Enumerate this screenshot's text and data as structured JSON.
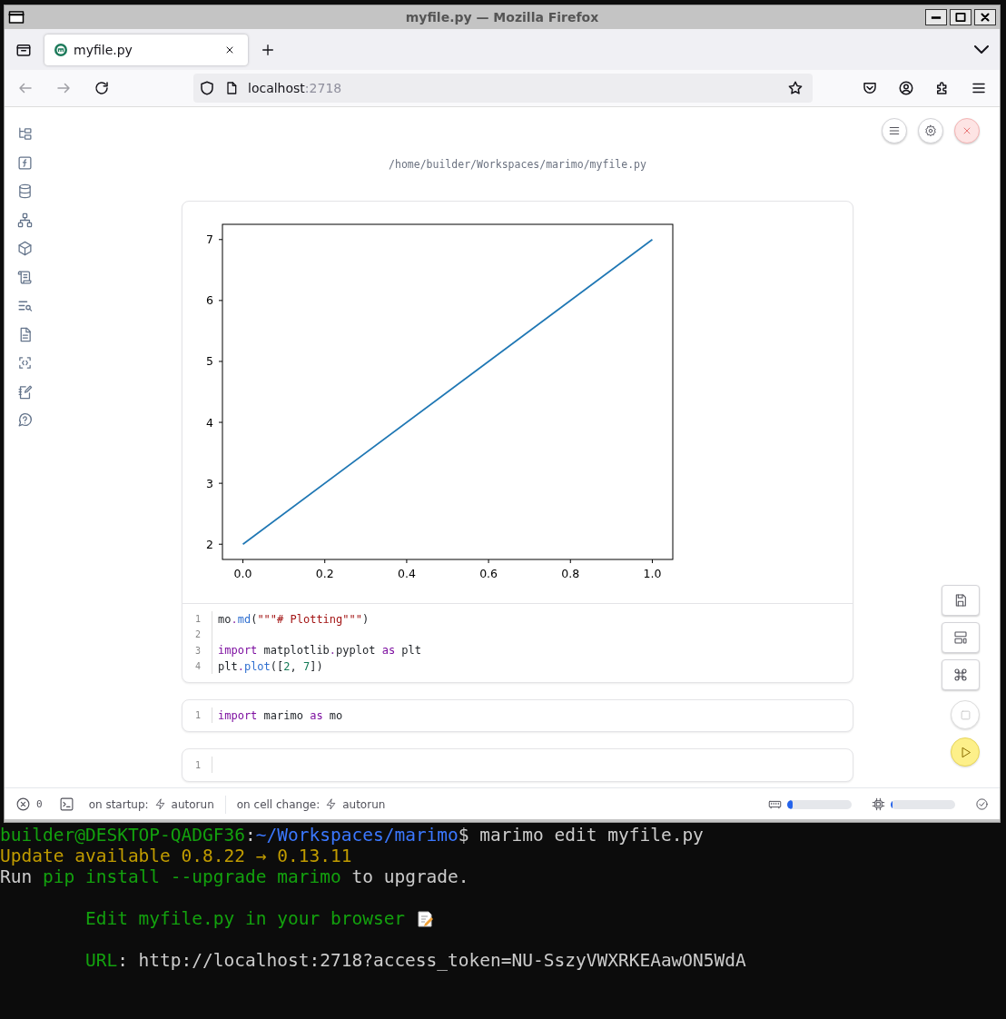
{
  "window": {
    "title": "myfile.py — Mozilla Firefox"
  },
  "tabs": [
    {
      "label": "myfile.py",
      "selected": true
    }
  ],
  "address_bar": {
    "host": "localhost",
    "port": ":2718"
  },
  "notebook": {
    "path": "/home/builder/Workspaces/marimo/myfile.py",
    "cells": [
      {
        "chart_data": {
          "type": "line",
          "x": [
            0,
            1
          ],
          "series": [
            {
              "color": "#1f77b4",
              "values": [
                2,
                7
              ]
            }
          ],
          "xlim": [
            -0.05,
            1.05
          ],
          "ylim": [
            1.75,
            7.25
          ],
          "xticks": [
            {
              "value": 0,
              "label": "0.0"
            },
            {
              "value": 0.2,
              "label": "0.2"
            },
            {
              "value": 0.4,
              "label": "0.4"
            },
            {
              "value": 0.6,
              "label": "0.6"
            },
            {
              "value": 0.8,
              "label": "0.8"
            },
            {
              "value": 1,
              "label": "1.0"
            }
          ],
          "yticks": [
            2,
            3,
            4,
            5,
            6,
            7
          ]
        },
        "lines": [
          {
            "number": "1",
            "tokens": [
              {
                "kind": "plain",
                "text": "mo"
              },
              {
                "kind": "punct",
                "text": "."
              },
              {
                "kind": "func",
                "text": "md"
              },
              {
                "kind": "plain",
                "text": "("
              },
              {
                "kind": "string",
                "text": "\"\"\"# Plotting\"\"\""
              },
              {
                "kind": "plain",
                "text": ")"
              }
            ]
          },
          {
            "number": "2"
          },
          {
            "number": "3",
            "tokens": [
              {
                "kind": "keyword",
                "text": "import"
              },
              {
                "kind": "plain",
                "text": " matplotlib"
              },
              {
                "kind": "punct",
                "text": "."
              },
              {
                "kind": "plain",
                "text": "pyplot "
              },
              {
                "kind": "keyword",
                "text": "as"
              },
              {
                "kind": "plain",
                "text": " plt"
              }
            ]
          },
          {
            "number": "4",
            "tokens": [
              {
                "kind": "plain",
                "text": "plt"
              },
              {
                "kind": "punct",
                "text": "."
              },
              {
                "kind": "func",
                "text": "plot"
              },
              {
                "kind": "plain",
                "text": "(["
              },
              {
                "kind": "number",
                "text": "2"
              },
              {
                "kind": "plain",
                "text": ", "
              },
              {
                "kind": "number",
                "text": "7"
              },
              {
                "kind": "plain",
                "text": "])"
              }
            ]
          }
        ]
      },
      {
        "lines": [
          {
            "number": "1",
            "tokens": [
              {
                "kind": "keyword",
                "text": "import"
              },
              {
                "kind": "plain",
                "text": " marimo "
              },
              {
                "kind": "keyword",
                "text": "as"
              },
              {
                "kind": "plain",
                "text": " mo"
              }
            ]
          }
        ]
      },
      {
        "lines": [
          {
            "number": "1"
          }
        ]
      }
    ]
  },
  "status_bar": {
    "errors": "0",
    "startup_label": "on startup:",
    "startup_mode": "autorun",
    "change_label": "on cell change:",
    "change_mode": "autorun",
    "memory": {
      "level": 0.08
    },
    "cpu": {
      "level": 0.03
    }
  },
  "terminal": {
    "lines": [
      {
        "kind": "plain",
        "segments": [
          {
            "kind": "prompt",
            "text": "builder@DESKTOP-QADGF36"
          },
          {
            "kind": "plain",
            "text": ":"
          },
          {
            "kind": "path",
            "text": "~/Workspaces/marimo"
          },
          {
            "kind": "plain",
            "text": "$ marimo edit myfile.py"
          }
        ]
      },
      {
        "kind": "plain",
        "segments": [
          {
            "kind": "warn",
            "text": "Update available 0.8.22 → 0.13.11"
          }
        ]
      },
      {
        "kind": "plain",
        "segments": [
          {
            "kind": "plain",
            "text": "Run "
          },
          {
            "kind": "green",
            "text": "pip install --upgrade marimo"
          },
          {
            "kind": "plain",
            "text": " to upgrade."
          }
        ]
      },
      {
        "kind": "banner",
        "segments": [
          {
            "kind": "green",
            "text": "Edit myfile.py in your browser"
          },
          {
            "kind": "memo"
          }
        ]
      },
      {
        "kind": "banner",
        "segments": [
          {
            "kind": "green",
            "text": "URL"
          },
          {
            "kind": "plain",
            "text": ": http://localhost:2718?access_token=NU-SszyVWXRKEAawON5WdA"
          }
        ]
      }
    ]
  }
}
